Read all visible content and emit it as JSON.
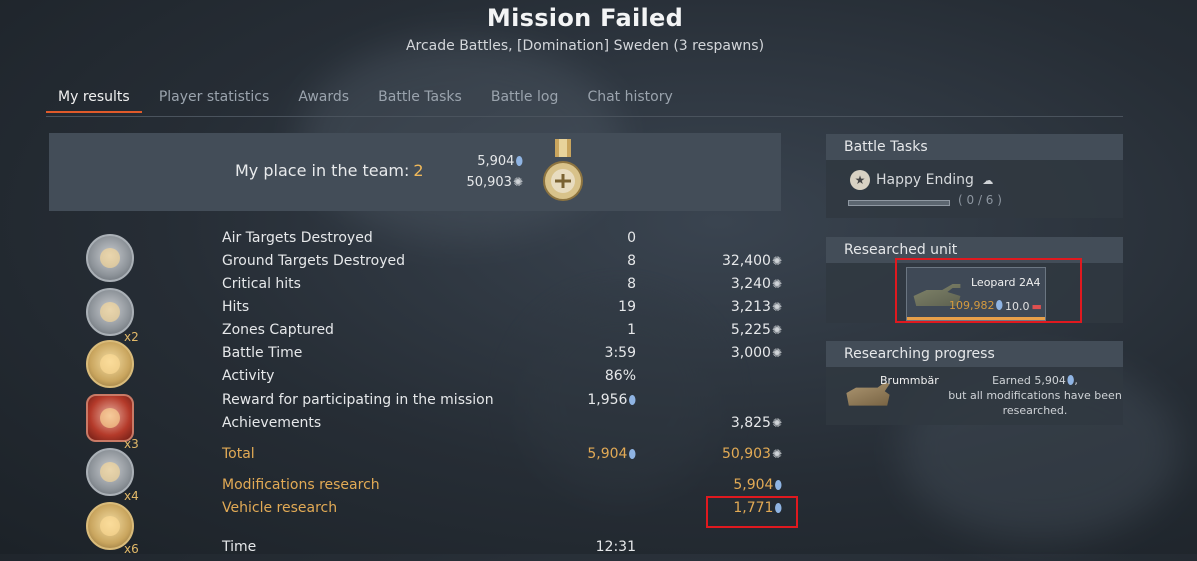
{
  "title": "Mission Failed",
  "subtitle": "Arcade Battles, [Domination] Sweden (3 respawns)",
  "tabs": [
    {
      "label": "My results",
      "active": true
    },
    {
      "label": "Player statistics"
    },
    {
      "label": "Awards"
    },
    {
      "label": "Battle Tasks"
    },
    {
      "label": "Battle log"
    },
    {
      "label": "Chat history"
    }
  ],
  "place": {
    "label": "My place in the team:",
    "value": "2",
    "research_points": "5,904",
    "silver_lions": "50,903"
  },
  "rows": [
    {
      "label": "Air Targets Destroyed",
      "value": "0",
      "reward": ""
    },
    {
      "label": "Ground Targets Destroyed",
      "value": "8",
      "reward": "32,400"
    },
    {
      "label": "Critical hits",
      "value": "8",
      "reward": "3,240"
    },
    {
      "label": "Hits",
      "value": "19",
      "reward": "3,213"
    },
    {
      "label": "Zones Captured",
      "value": "1",
      "reward": "5,225"
    },
    {
      "label": "Battle Time",
      "value": "3:59",
      "reward": "3,000"
    },
    {
      "label": "Activity",
      "value": "86%",
      "reward": ""
    },
    {
      "label": "Reward for participating in the mission",
      "value": "1,956",
      "reward": ""
    },
    {
      "label": "Achievements",
      "value": "",
      "reward": "3,825"
    }
  ],
  "total": {
    "label": "Total",
    "rp": "5,904",
    "sl": "50,903"
  },
  "modifications": {
    "label": "Modifications research",
    "rp": "5,904"
  },
  "vehicle_research": {
    "label": "Vehicle research",
    "rp": "1,771"
  },
  "time_row": {
    "label": "Time",
    "value": "12:31"
  },
  "multipliers": [
    "x2",
    "x3",
    "x4",
    "x6"
  ],
  "battle_tasks": {
    "header": "Battle Tasks",
    "task_name": "Happy Ending",
    "progress_text": "( 0 / 6 )",
    "progress_fraction": 0.0
  },
  "researched_unit": {
    "header": "Researched unit",
    "name": "Leopard 2A4",
    "rp": "109,982",
    "br": "10.0"
  },
  "researching_progress": {
    "header": "Researching progress",
    "vehicle": "Brummbär",
    "line1": "Earned 5,904",
    "line2": "but all modifications have been researched."
  },
  "colors": {
    "accent": "#e05a2a",
    "gold": "#e2aa55",
    "highlight": "#e0191f"
  }
}
